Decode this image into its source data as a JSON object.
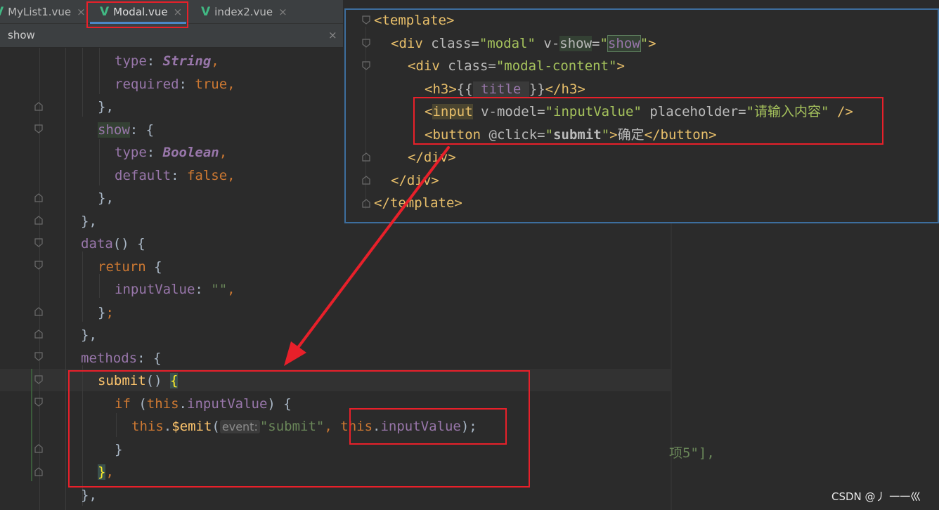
{
  "tabs": [
    {
      "label": "MyList1.vue",
      "active": false
    },
    {
      "label": "Modal.vue",
      "active": true
    },
    {
      "label": "index2.vue",
      "active": false
    }
  ],
  "search": {
    "query": "show",
    "close": "×"
  },
  "tab_close": "×",
  "vue_icon": "V",
  "code": {
    "l1": {
      "prop": "type",
      "colon": ": ",
      "val": "String",
      "comma": ","
    },
    "l2": {
      "prop": "required",
      "colon": ": ",
      "val": "true",
      "comma": ","
    },
    "l3": {
      "text": "},"
    },
    "l4": {
      "prop": "show",
      "rest": ": {"
    },
    "l5": {
      "prop": "type",
      "colon": ": ",
      "val": "Boolean",
      "comma": ","
    },
    "l6": {
      "prop": "default",
      "colon": ": ",
      "val": "false",
      "comma": ","
    },
    "l7": {
      "text": "},"
    },
    "l8": {
      "text": "},"
    },
    "l9": {
      "fn": "data",
      "rest": "() {"
    },
    "l10": {
      "kw": "return",
      "rest": " {"
    },
    "l11": {
      "prop": "inputValue",
      "colon": ": ",
      "val": "\"\"",
      "comma": ","
    },
    "l12": {
      "text": "}",
      "semi": ";"
    },
    "l13": {
      "text": "},"
    },
    "l14": {
      "prop": "methods",
      "rest": ": {"
    },
    "l15": {
      "fn": "submit",
      "rest": "() ",
      "brace": "{"
    },
    "l16": {
      "kw": "if",
      "open": " (",
      "this": "this",
      "dot": ".",
      "prop": "inputValue",
      "close": ") {"
    },
    "l17": {
      "this": "this",
      "dot": ".",
      "fn": "$emit",
      "open": "(",
      "hint": "event:",
      "str": "\"submit\"",
      "comma": ", ",
      "this2": "this",
      "dot2": ".",
      "prop": "inputValue",
      "close": ");"
    },
    "l18": {
      "text": "}"
    },
    "l19": {
      "brace": "}",
      "comma": ","
    },
    "l20": {
      "text": "},"
    }
  },
  "template": {
    "t1": {
      "open": "<",
      "tag": "template",
      "close": ">"
    },
    "t2": {
      "open": "<",
      "tag": "div",
      "a1": " class=",
      "v1": "\"modal\"",
      "a2": " v-",
      "a2b": "show",
      "eq": "=",
      "q1": "\"",
      "v2": "show",
      "q2": "\"",
      "close": ">"
    },
    "t3": {
      "open": "<",
      "tag": "div",
      "a1": " class=",
      "v1": "\"modal-content\"",
      "close": ">"
    },
    "t4": {
      "open": "<",
      "tag": "h3",
      "close": ">",
      "mus1": "{{",
      "expr": " title ",
      "mus2": "}}",
      "end": "</h3>"
    },
    "t5": {
      "open": "<",
      "tag": "input",
      "a1": " v-model=",
      "v1": "\"inputValue\"",
      "a2": " placeholder=",
      "v2": "\"请输入内容\"",
      "close": " />"
    },
    "t6": {
      "open": "<",
      "tag": "button",
      "a1": " @click=",
      "q1": "\"",
      "v1": "submit",
      "q2": "\"",
      "close": ">",
      "text": "确定",
      "end": "</button>"
    },
    "t7": {
      "text": "</div>"
    },
    "t8": {
      "text": "</div>"
    },
    "t9": {
      "text": "</template>"
    }
  },
  "peek_text": "项5\"],",
  "watermark": "CSDN @丿 一一巛",
  "colors": {
    "annotation": "#e8202a",
    "vue": "#41b883",
    "popup_border": "#3d6e9e"
  }
}
